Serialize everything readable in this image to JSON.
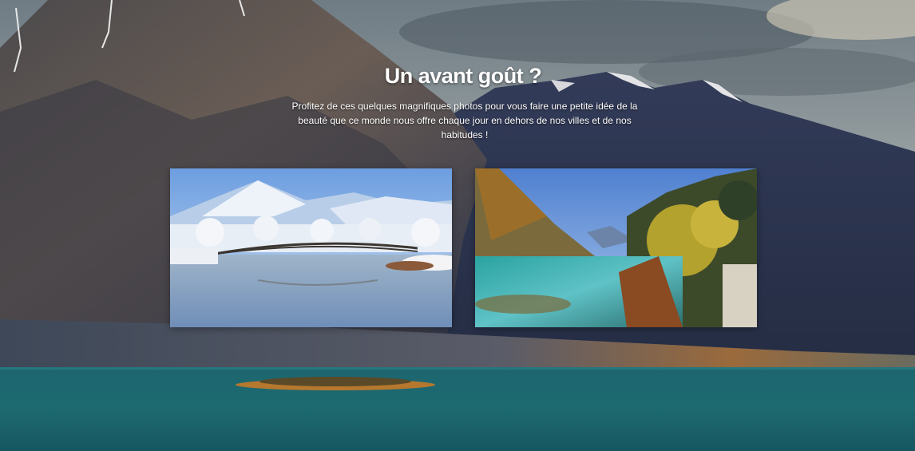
{
  "section": {
    "title": "Un avant goût ?",
    "description": "Profitez de ces quelques magnifiques photos pour vous faire une petite idée de la beauté que ce monde nous offre chaque jour en dehors de nos villes et de nos habitudes !"
  },
  "gallery": {
    "photos": [
      {
        "subject": "snowy-mountain-bridge-lake"
      },
      {
        "subject": "autumn-forest-turquoise-lake"
      }
    ]
  },
  "colors": {
    "text": "#ffffff",
    "lake": "#1d6670",
    "sky": "#8a9aa6"
  }
}
